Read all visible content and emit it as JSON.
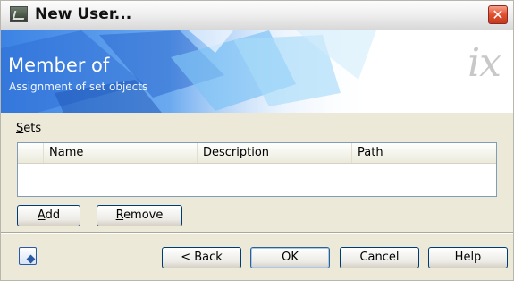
{
  "window": {
    "title": "New User...",
    "close_glyph": "✕"
  },
  "banner": {
    "title": "Member of",
    "subtitle": "Assignment of set objects",
    "logo": "ix"
  },
  "sets": {
    "label_accel": "S",
    "label_rest": "ets",
    "columns": [
      "Name",
      "Description",
      "Path"
    ],
    "rows": [],
    "add_accel": "A",
    "add_rest": "dd",
    "remove_accel": "R",
    "remove_rest": "emove"
  },
  "footer": {
    "back": "< Back",
    "ok": "OK",
    "cancel": "Cancel",
    "help": "Help",
    "icon": "info-icon"
  },
  "colors": {
    "window_bg": "#ece9d8",
    "banner_blue": "#3a7ee0",
    "button_border": "#003c74"
  }
}
